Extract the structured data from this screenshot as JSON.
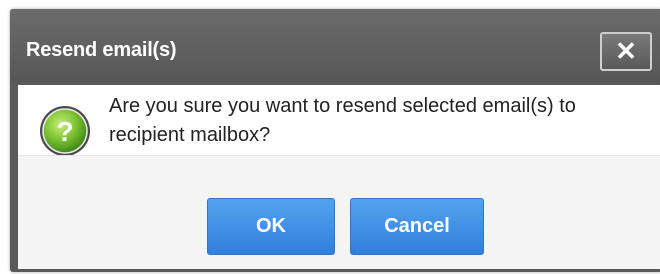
{
  "dialog": {
    "title": "Resend email(s)",
    "close_label": "✕",
    "message": "Are you sure you want to resend selected email(s) to recipient mailbox?",
    "ok_label": "OK",
    "cancel_label": "Cancel"
  },
  "colors": {
    "titlebar": "#5f5f5f",
    "button": "#3b8de6",
    "icon_green": "#6fb52c"
  }
}
